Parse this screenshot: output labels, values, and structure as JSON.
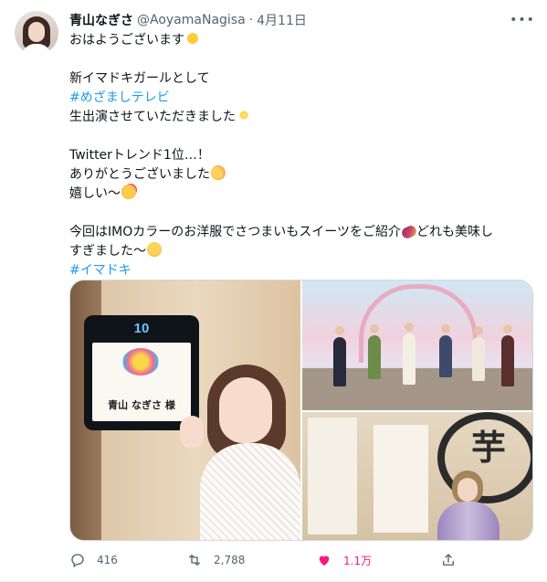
{
  "tweet": {
    "author_name": "青山なぎさ",
    "handle": "@AoyamaNagisa",
    "separator": "·",
    "date": "4月11日",
    "more_label": "•••",
    "lines": {
      "l1": "おはようございます",
      "l2": "新イマドキガールとして",
      "l3_hashtag": "#めざましテレビ",
      "l4": "生出演させていただきました",
      "l5": "Twitterトレンド1位…！",
      "l6": "ありがとうございました",
      "l7": "嬉しい〜",
      "l8a": "今回はIMOカラーのお洋服でさつまいもスイーツをご紹介",
      "l8b": "どれも美味し",
      "l9": "すぎました〜",
      "l10_hashtag": "#イマドキ"
    },
    "emoji": {
      "l1": "sun-emoji",
      "l4": "sparkles-emoji",
      "l6": "flushed-face-emoji",
      "l7": "smiling-face-with-hearts-emoji",
      "l8": "sweet-potato-emoji",
      "l9": "relieved-face-emoji"
    },
    "media": {
      "photo1": {
        "plate_number": "10",
        "name_card": "青山 なぎさ 様"
      },
      "photo3": {
        "sign_char": "芋"
      }
    },
    "actions": {
      "reply_count": "416",
      "retweet_count": "2,788",
      "like_count": "1.1万"
    }
  },
  "colors": {
    "text": "#0f1419",
    "secondary": "#536471",
    "link": "#1d9bf0",
    "like": "#f91880"
  }
}
